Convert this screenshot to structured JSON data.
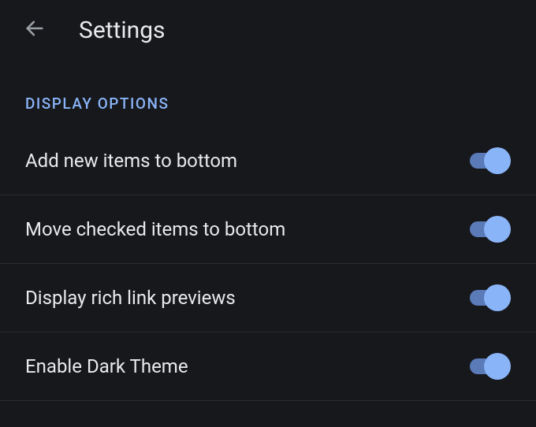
{
  "header": {
    "title": "Settings"
  },
  "section": {
    "label": "DISPLAY OPTIONS"
  },
  "colors": {
    "accent": "#8ab4f8",
    "background": "#16181c"
  },
  "settings": [
    {
      "label": "Add new items to bottom",
      "on": true
    },
    {
      "label": "Move checked items to bottom",
      "on": true
    },
    {
      "label": "Display rich link previews",
      "on": true
    },
    {
      "label": "Enable Dark Theme",
      "on": true
    }
  ]
}
